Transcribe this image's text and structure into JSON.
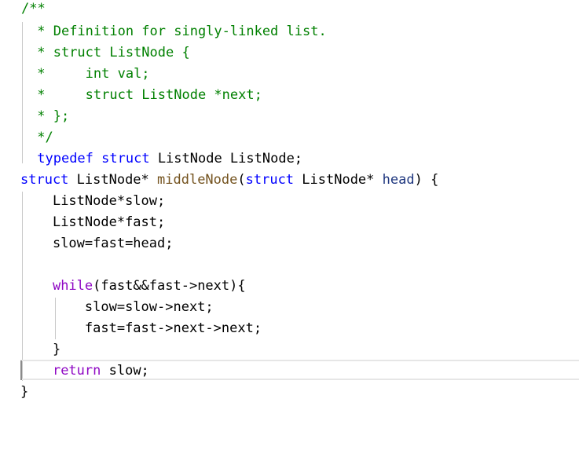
{
  "editor": {
    "lines": [
      {
        "indent": "",
        "tokens": [
          {
            "text": "/**",
            "kind": "comment"
          }
        ]
      },
      {
        "indent": " ",
        "tokens": [
          {
            "text": "* Definition for singly-linked list.",
            "kind": "comment"
          }
        ]
      },
      {
        "indent": " ",
        "tokens": [
          {
            "text": "* struct ListNode {",
            "kind": "comment"
          }
        ]
      },
      {
        "indent": " ",
        "tokens": [
          {
            "text": "*     int val;",
            "kind": "comment"
          }
        ]
      },
      {
        "indent": " ",
        "tokens": [
          {
            "text": "*     struct ListNode *next;",
            "kind": "comment"
          }
        ]
      },
      {
        "indent": " ",
        "tokens": [
          {
            "text": "* };",
            "kind": "comment"
          }
        ]
      },
      {
        "indent": " ",
        "tokens": [
          {
            "text": "*/",
            "kind": "comment"
          }
        ]
      },
      {
        "indent": " ",
        "tokens": [
          {
            "text": "typedef",
            "kind": "keyword"
          },
          {
            "text": " ",
            "kind": "plain"
          },
          {
            "text": "struct",
            "kind": "keyword"
          },
          {
            "text": " ListNode ListNode;",
            "kind": "plain"
          }
        ]
      },
      {
        "indent": "",
        "tokens": [
          {
            "text": "struct",
            "kind": "keyword"
          },
          {
            "text": " ListNode* ",
            "kind": "plain"
          },
          {
            "text": "middleNode",
            "kind": "func"
          },
          {
            "text": "(",
            "kind": "plain"
          },
          {
            "text": "struct",
            "kind": "keyword"
          },
          {
            "text": " ListNode* ",
            "kind": "plain"
          },
          {
            "text": "head",
            "kind": "param"
          },
          {
            "text": ") {",
            "kind": "plain"
          }
        ]
      },
      {
        "indent": "    ",
        "tokens": [
          {
            "text": "ListNode*slow;",
            "kind": "plain"
          }
        ]
      },
      {
        "indent": "    ",
        "tokens": [
          {
            "text": "ListNode*fast;",
            "kind": "plain"
          }
        ]
      },
      {
        "indent": "    ",
        "tokens": [
          {
            "text": "slow=fast=head;",
            "kind": "plain"
          }
        ]
      },
      {
        "indent": "",
        "tokens": []
      },
      {
        "indent": "    ",
        "tokens": [
          {
            "text": "while",
            "kind": "control"
          },
          {
            "text": "(fast&&fast->next){",
            "kind": "plain"
          }
        ]
      },
      {
        "indent": "        ",
        "tokens": [
          {
            "text": "slow=slow->next;",
            "kind": "plain"
          }
        ]
      },
      {
        "indent": "        ",
        "tokens": [
          {
            "text": "fast=fast->next->next;",
            "kind": "plain"
          }
        ]
      },
      {
        "indent": "    ",
        "tokens": [
          {
            "text": "}",
            "kind": "plain"
          }
        ]
      },
      {
        "indent": "    ",
        "tokens": [
          {
            "text": "return",
            "kind": "control"
          },
          {
            "text": " slow;",
            "kind": "plain"
          }
        ]
      },
      {
        "indent": "",
        "tokens": [
          {
            "text": "}",
            "kind": "plain"
          }
        ]
      }
    ]
  },
  "colors": {
    "background": "#ffffff",
    "comment": "#008000",
    "keyword": "#0000ff",
    "control": "#8f08c4",
    "type": "#2b91af",
    "function": "#74531f",
    "parameter": "#1f377f",
    "plain": "#000000",
    "indent_guide": "#c8c8c8",
    "current_line_border": "#e6e6e6"
  }
}
